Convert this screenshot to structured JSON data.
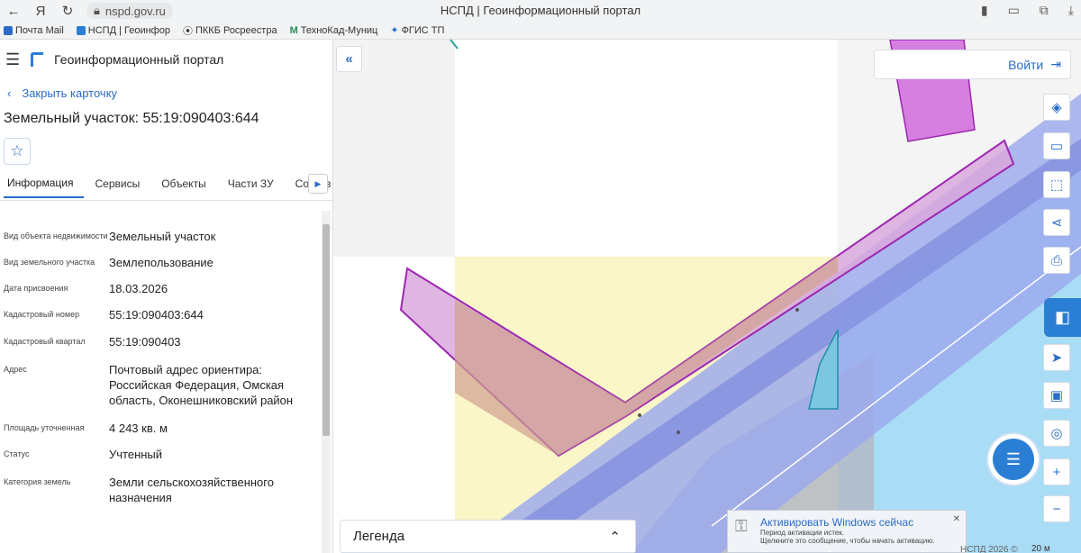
{
  "browser": {
    "url": "nspd.gov.ru",
    "tab_title": "НСПД | Геоинформационный портал",
    "bookmarks": [
      {
        "label": "Почта Mail",
        "icon": "mail-icon",
        "color": "#2a6cc7"
      },
      {
        "label": "НСПД | Геоинфор",
        "icon": "nspd-icon",
        "color": "#2a7fd4"
      },
      {
        "label": "ПККБ Росреестра",
        "icon": "pin-icon",
        "color": "#333333"
      },
      {
        "label": "ТехноКад-Муниц",
        "icon": "m-icon",
        "color": "#2e8b57"
      },
      {
        "label": "ФГИС ТП",
        "icon": "emblem-icon",
        "color": "#2a6cc7"
      }
    ]
  },
  "app": {
    "title": "Геоинформационный портал"
  },
  "card": {
    "close_label": "Закрыть карточку",
    "title": "Земельный участок: 55:19:090403:644",
    "tabs": [
      "Информация",
      "Сервисы",
      "Объекты",
      "Части ЗУ",
      "Состав"
    ],
    "active_tab": "Информация",
    "properties": [
      {
        "key": "Вид объекта недвижимости",
        "value": "Земельный участок"
      },
      {
        "key": "Вид земельного участка",
        "value": "Землепользование"
      },
      {
        "key": "Дата присвоения",
        "value": "18.03.2026"
      },
      {
        "key": "Кадастровый номер",
        "value": "55:19:090403:644"
      },
      {
        "key": "Кадастровый квартал",
        "value": "55:19:090403"
      },
      {
        "key": "Адрес",
        "value": "Почтовый адрес ориентира: Российская Федерация, Омская область, Оконешниковский район"
      },
      {
        "key": "Площадь уточненная",
        "value": "4 243 кв. м"
      },
      {
        "key": "Статус",
        "value": "Учтенный"
      },
      {
        "key": "Категория земель",
        "value": "Земли сельскохозяйственного назначения"
      }
    ]
  },
  "map": {
    "login_label": "Войти",
    "legend_label": "Легенда",
    "attribution": "НСПД 2026 ©",
    "scale": "20 м",
    "tools": [
      "layers-icon",
      "ruler-icon",
      "select-area-icon",
      "share-icon",
      "print-icon",
      "egrn-icon",
      "locate-icon",
      "minimap-icon",
      "search-map-icon",
      "zoom-in-icon",
      "zoom-out-icon"
    ],
    "colors": {
      "accent": "#2a7fd4",
      "road_band": "#9aa8ee",
      "water": "#a9dcf5",
      "parcel_stroke": "#9c27b0",
      "parcel_fill": "#d9a8dd",
      "field_yellow": "#fbf6c8",
      "selected_fill": "#cf9f8f"
    }
  },
  "windows_activation": {
    "title": "Активировать Windows сейчас",
    "line1": "Период активации истек.",
    "line2": "Щелкните это сообщение, чтобы начать активацию."
  }
}
